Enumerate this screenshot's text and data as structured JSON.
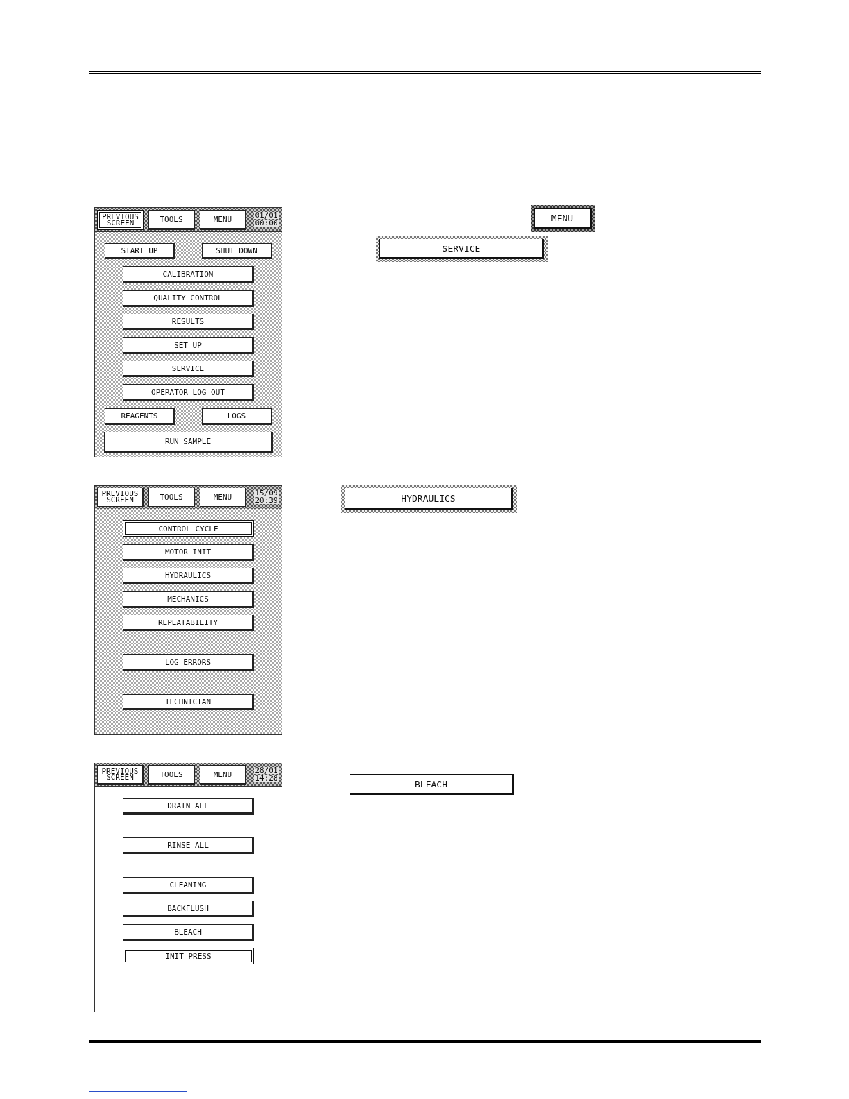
{
  "sections": [
    {
      "screen": {
        "dotted": true,
        "header": {
          "buttons": [
            {
              "label": "PREVIOUS SCREEN",
              "selected": true
            },
            {
              "label": "TOOLS",
              "selected": false
            },
            {
              "label": "MENU",
              "selected": false
            }
          ],
          "date": "01/01",
          "time": "00:00"
        },
        "groups": [
          {
            "items": [
              {
                "kind": "pair",
                "buttons": [
                  {
                    "label": "START UP",
                    "selected": false
                  },
                  {
                    "label": "SHUT DOWN",
                    "selected": false
                  }
                ]
              },
              {
                "kind": "single",
                "label": "CALIBRATION",
                "selected": false
              },
              {
                "kind": "single",
                "label": "QUALITY CONTROL",
                "selected": false
              },
              {
                "kind": "single",
                "label": "RESULTS",
                "selected": false
              },
              {
                "kind": "single",
                "label": "SET UP",
                "selected": false
              },
              {
                "kind": "single",
                "label": "SERVICE",
                "selected": false
              },
              {
                "kind": "single",
                "label": "OPERATOR LOG OUT",
                "selected": false
              },
              {
                "kind": "pair",
                "buttons": [
                  {
                    "label": "REAGENTS",
                    "selected": false
                  },
                  {
                    "label": "LOGS",
                    "selected": false
                  }
                ]
              },
              {
                "kind": "wide",
                "label": "RUN SAMPLE",
                "selected": false
              }
            ]
          }
        ]
      },
      "callouts": [
        {
          "label": "MENU",
          "kind": "dark-frame"
        },
        {
          "label": "SERVICE",
          "kind": "light-frame"
        }
      ]
    },
    {
      "screen": {
        "dotted": true,
        "header": {
          "buttons": [
            {
              "label": "PREVIOUS SCREEN",
              "selected": false
            },
            {
              "label": "TOOLS",
              "selected": false
            },
            {
              "label": "MENU",
              "selected": false
            }
          ],
          "date": "15/09",
          "time": "20:39"
        },
        "groups": [
          {
            "items": [
              {
                "kind": "single",
                "label": "CONTROL CYCLE",
                "selected": true
              },
              {
                "kind": "single",
                "label": "MOTOR INIT",
                "selected": false
              },
              {
                "kind": "single",
                "label": "HYDRAULICS",
                "selected": false
              },
              {
                "kind": "single",
                "label": "MECHANICS",
                "selected": false
              },
              {
                "kind": "single",
                "label": "REPEATABILITY",
                "selected": false
              }
            ]
          },
          {
            "items": [
              {
                "kind": "single",
                "label": "LOG ERRORS",
                "selected": false
              }
            ]
          },
          {
            "items": [
              {
                "kind": "single",
                "label": "TECHNICIAN",
                "selected": false
              }
            ]
          }
        ]
      },
      "callouts": [
        {
          "label": "HYDRAULICS",
          "kind": "light-frame"
        }
      ]
    },
    {
      "screen": {
        "dotted": false,
        "header": {
          "buttons": [
            {
              "label": "PREVIOUS SCREEN",
              "selected": false
            },
            {
              "label": "TOOLS",
              "selected": false
            },
            {
              "label": "MENU",
              "selected": false
            }
          ],
          "date": "28/01",
          "time": "14:28"
        },
        "groups": [
          {
            "items": [
              {
                "kind": "single",
                "label": "DRAIN ALL",
                "selected": false
              }
            ]
          },
          {
            "items": [
              {
                "kind": "single",
                "label": "RINSE ALL",
                "selected": false
              }
            ]
          },
          {
            "items": [
              {
                "kind": "single",
                "label": "CLEANING",
                "selected": false
              },
              {
                "kind": "single",
                "label": "BACKFLUSH",
                "selected": false
              },
              {
                "kind": "single",
                "label": "BLEACH",
                "selected": false
              },
              {
                "kind": "single",
                "label": "INIT PRESS",
                "selected": true
              }
            ]
          }
        ]
      },
      "callouts": [
        {
          "label": "BLEACH",
          "kind": "plain"
        }
      ]
    }
  ]
}
